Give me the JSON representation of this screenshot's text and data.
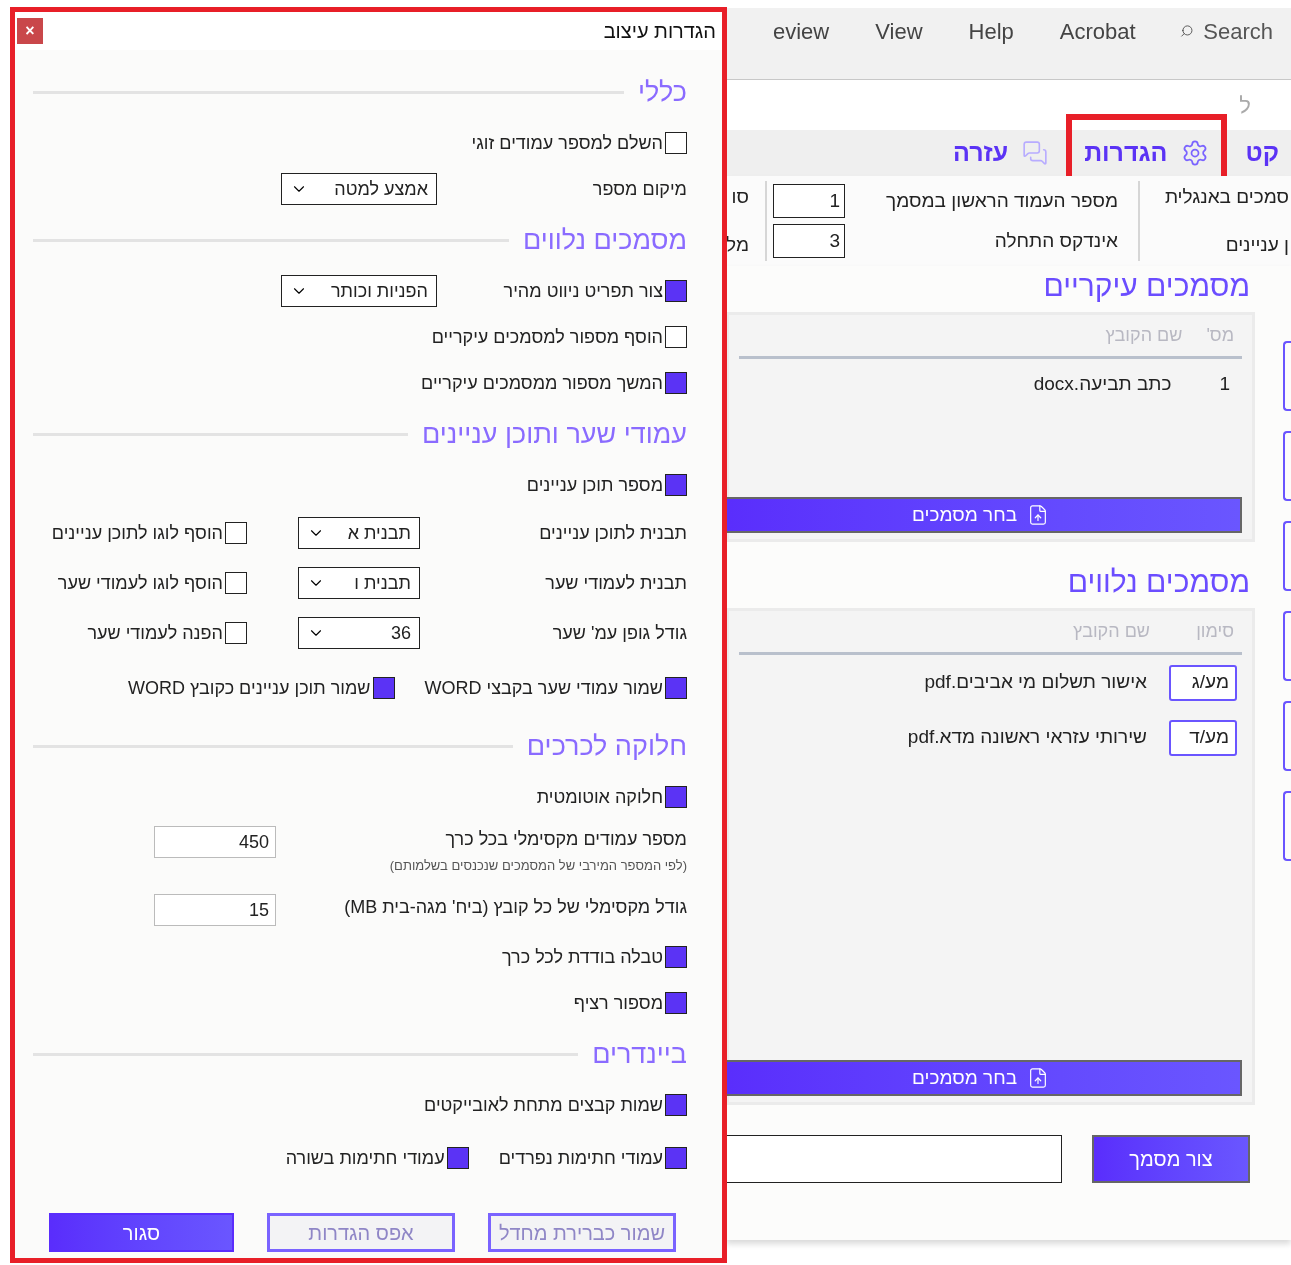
{
  "dialog": {
    "title": "הגדרות עיצוב",
    "close_label": "×",
    "sections": [
      {
        "heading": "כללי",
        "rows": [
          {
            "kind": "check",
            "label": "השלם למספר עמודים זוגי",
            "checked": false
          },
          {
            "kind": "select",
            "label": "מיקום מספר",
            "value": "אמצע למטה"
          }
        ]
      },
      {
        "heading": "מסמכים נלווים",
        "rows": [
          {
            "kind": "check_select",
            "label": "צור תפריט ניווט מהיר",
            "checked": true,
            "value": "הפניות וכותר"
          },
          {
            "kind": "check",
            "label": "הוסף מספור למסמכים עיקריים",
            "checked": false
          },
          {
            "kind": "check",
            "label": "המשך מספור ממסמכים עיקריים",
            "checked": true
          }
        ]
      },
      {
        "heading": "עמודי שער ותוכן עניינים",
        "rows": [
          {
            "kind": "check",
            "label": "מספר תוכן עניינים",
            "checked": true
          },
          {
            "kind": "select_check",
            "label": "תבנית לתוכן עניינים",
            "value": "תבנית א",
            "option": {
              "label": "הוסף לוגו לתוכן עניינים",
              "checked": false
            }
          },
          {
            "kind": "select_check",
            "label": "תבנית לעמודי שער",
            "value": "תבנית ו",
            "option": {
              "label": "הוסף לוגו לעמודי שער",
              "checked": false
            }
          },
          {
            "kind": "select_check",
            "label": "גודל גופן עמ' שער",
            "value": "36",
            "option": {
              "label": "הפנה לעמודי שער",
              "checked": false
            }
          },
          {
            "kind": "check_pair",
            "items": [
              {
                "label": "שמור עמודי שער בקבצי WORD",
                "checked": true
              },
              {
                "label": "שמור תוכן עניינים כקובץ WORD",
                "checked": true
              }
            ]
          }
        ]
      },
      {
        "heading": "חלוקה לכרכים",
        "rows": [
          {
            "kind": "check",
            "label": "חלוקה אוטומטית",
            "checked": true
          },
          {
            "kind": "input",
            "label": "מספר עמודים מקסימלי בכל כרך",
            "value": "450",
            "hint": "(לפי המספר המירבי של המסמכים שנכנסים בשלמותם)"
          },
          {
            "kind": "input",
            "label": "גודל מקסימלי של כל קובץ (ביח' מגה-בית MB)",
            "value": "15"
          },
          {
            "kind": "check",
            "label": "טבלה בודדת לכל כרך",
            "checked": true
          },
          {
            "kind": "check",
            "label": "מספור רציף",
            "checked": true
          }
        ]
      },
      {
        "heading": "ביינדרים",
        "rows": [
          {
            "kind": "check",
            "label": "שמות קבצים מתחת לאובייקטים",
            "checked": true
          },
          {
            "kind": "check_pair",
            "items": [
              {
                "label": "עמודי חתימות נפרדים",
                "checked": true
              },
              {
                "label": "עמודי חתימות בשורה",
                "checked": true
              }
            ]
          }
        ]
      }
    ],
    "buttons": [
      {
        "label": "שמור כברירת מחדל",
        "kind": "outline"
      },
      {
        "label": "אפס הגדרות",
        "kind": "outline"
      },
      {
        "label": "סגור",
        "kind": "primary"
      }
    ]
  },
  "app": {
    "menu": [
      "Acrobat",
      "Help",
      "View",
      "eview"
    ],
    "search_label": "Search",
    "corner_text": "ל",
    "ribbon": [
      {
        "label": "קט",
        "kind": "text",
        "highlighted": false
      },
      {
        "label": "הגדרות",
        "kind": "settings",
        "highlighted": true
      },
      {
        "label": "עזרה",
        "kind": "help",
        "highlighted": false
      }
    ],
    "options": {
      "column_1": [
        "סמכים באנגלית",
        "ן עניינים"
      ],
      "fields": [
        {
          "label": "מספר העמוד הראשון במסמך",
          "value": "1"
        },
        {
          "label": "אינדקס התחלה",
          "value": "3"
        }
      ],
      "column_3": [
        "סו",
        "מל"
      ]
    },
    "main_documents": {
      "heading": "מסמכים עיקריים",
      "columns": [
        "מס'",
        "שם הקובץ"
      ],
      "rows": [
        {
          "number": "1",
          "file": "כתב תביעה.docx"
        }
      ],
      "button": "בחר מסמכים"
    },
    "attached_documents": {
      "heading": "מסמכים נלווים",
      "columns": [
        "סימון",
        "שם הקובץ"
      ],
      "rows": [
        {
          "mark": "מע/ג",
          "file": "אישור תשלום מי אביבים.pdf"
        },
        {
          "mark": "מע/ד",
          "file": "שירותי עזראי ראשונה מדא.pdf"
        }
      ],
      "button": "בחר מסמכים"
    },
    "create_button": "צור מסמך"
  }
}
